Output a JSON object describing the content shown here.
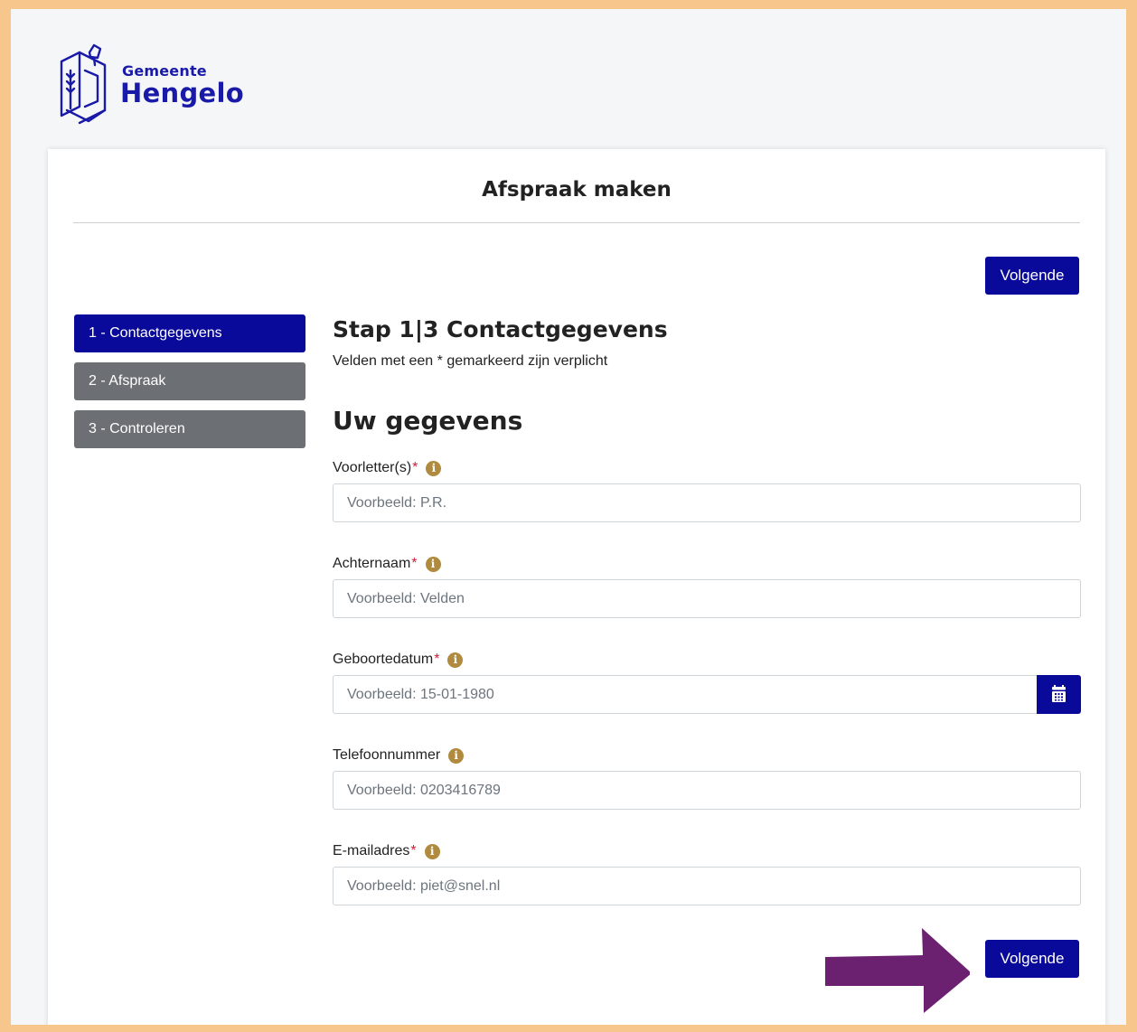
{
  "brand": {
    "line1": "Gemeente",
    "line2": "Hengelo",
    "color": "#1a1aa8"
  },
  "card": {
    "title": "Afspraak maken"
  },
  "buttons": {
    "next_top": "Volgende",
    "next_bottom": "Volgende"
  },
  "steps": [
    {
      "label": "1 - Contactgegevens",
      "active": true
    },
    {
      "label": "2 - Afspraak",
      "active": false
    },
    {
      "label": "3 - Controleren",
      "active": false
    }
  ],
  "form": {
    "step_heading": "Stap 1|3 Contactgegevens",
    "required_note": "Velden met een * gemarkeerd zijn verplicht",
    "section_heading": "Uw gegevens",
    "required_marker": "*",
    "info_glyph": "i",
    "fields": [
      {
        "label": "Voorletter(s)",
        "required": true,
        "placeholder": "Voorbeeld: P.R.",
        "value": ""
      },
      {
        "label": "Achternaam",
        "required": true,
        "placeholder": "Voorbeeld: Velden",
        "value": ""
      },
      {
        "label": "Geboortedatum",
        "required": true,
        "placeholder": "Voorbeeld: 15-01-1980",
        "value": "",
        "icon": "calendar-icon"
      },
      {
        "label": "Telefoonnummer",
        "required": false,
        "placeholder": "Voorbeeld: 0203416789",
        "value": ""
      },
      {
        "label": "E-mailadres",
        "required": true,
        "placeholder": "Voorbeeld: piet@snel.nl",
        "value": ""
      }
    ]
  },
  "colors": {
    "primary": "#0a0a9a",
    "step_inactive": "#6c6f73",
    "info": "#b08a3e",
    "required": "#d0203a",
    "page_frame": "#f6c68c",
    "arrow": "#6b2070"
  }
}
